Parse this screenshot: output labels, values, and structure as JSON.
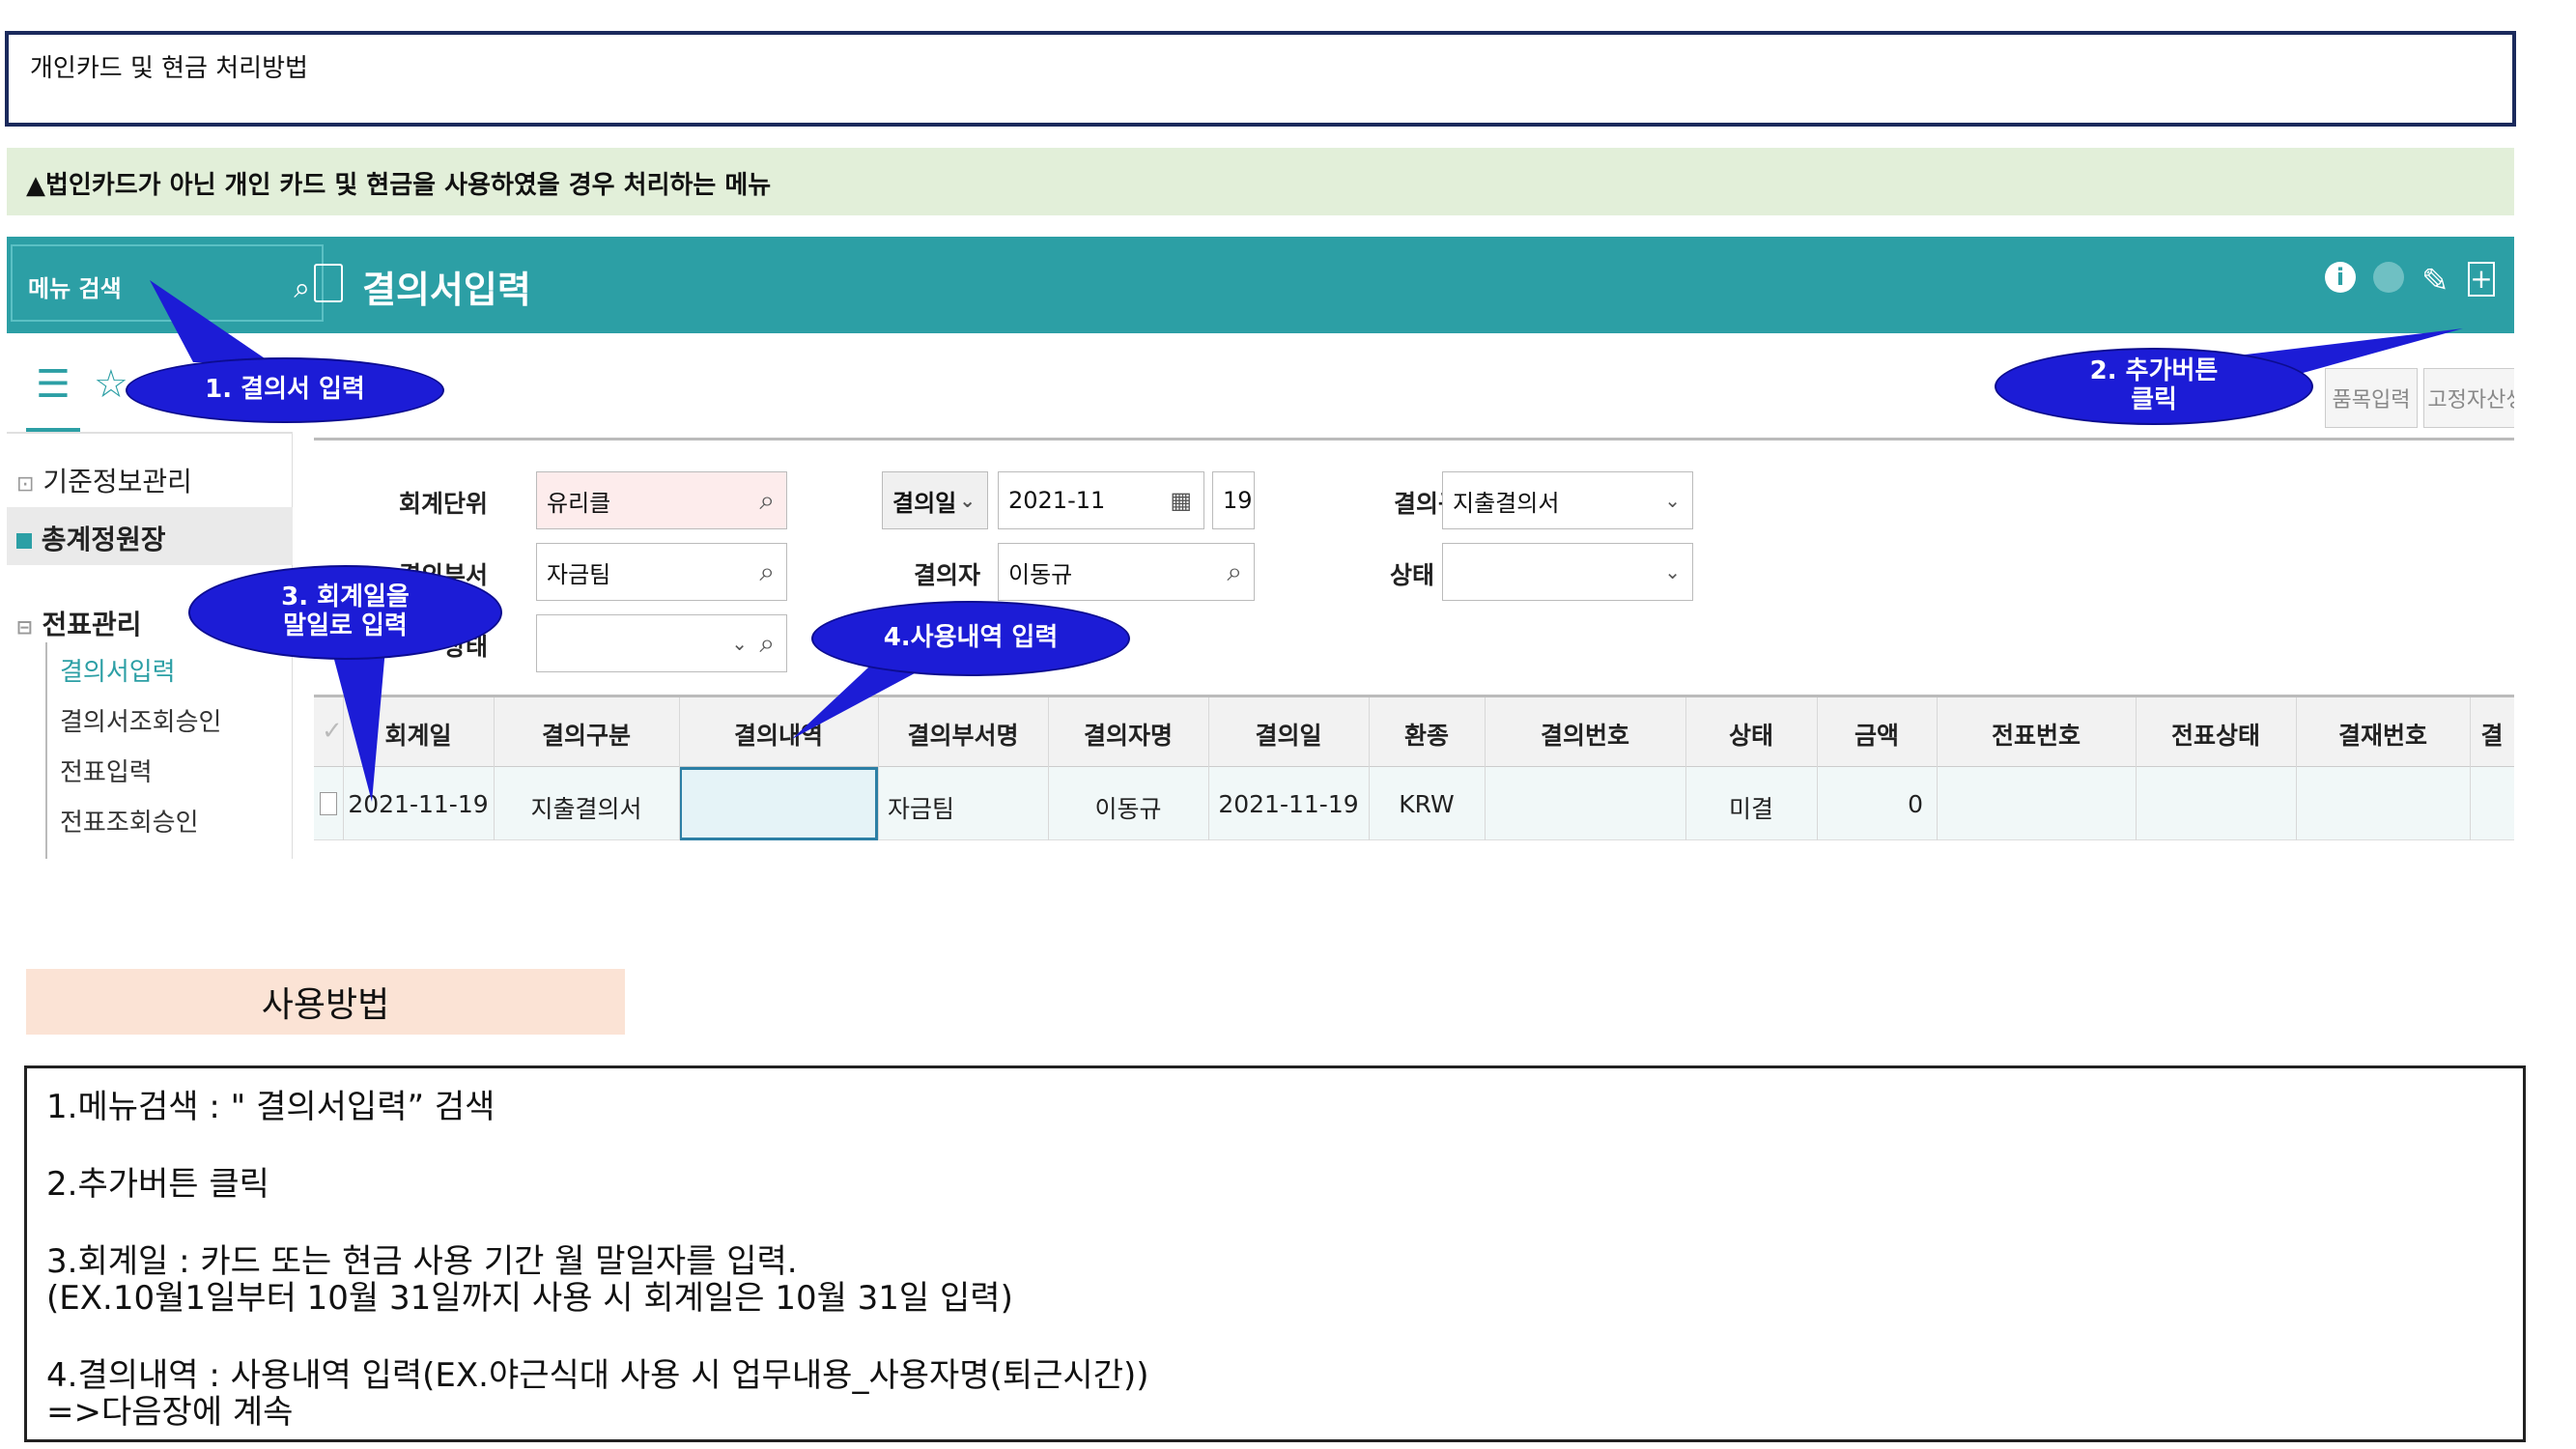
{
  "title": "개인카드 및 현금 처리방법",
  "subtitle": "▲법인카드가 아닌 개인 카드 및 현금을 사용하였을 경우 처리하는 메뉴",
  "app": {
    "menu_search_label": "메뉴 검색",
    "window_title": "결의서입력",
    "icons": [
      "info-icon",
      "globe-icon",
      "pen-icon",
      "add-icon"
    ],
    "buttons": {
      "item_input": "품목입력",
      "fixed_asset": "고정자산생"
    },
    "sidebar": {
      "items": [
        "기준정보관리",
        "총계정원장",
        "전표관리"
      ],
      "sub_items": [
        "결의서입력",
        "결의서조회승인",
        "전표입력",
        "전표조회승인"
      ]
    },
    "form": {
      "accounting_unit_label": "회계단위",
      "accounting_unit_value": "유리클",
      "resolution_date_label": "결의일",
      "resolution_date_value": "2021-11",
      "resolution_day_value": "19",
      "resolution_type_label": "결의구분",
      "resolution_type_value": "지출결의서",
      "dept_label": "결의부서",
      "dept_value": "자금팀",
      "resolver_label": "결의자",
      "resolver_value": "이동규",
      "status_label": "상태",
      "status_value": "",
      "state_label_partial": "상태"
    },
    "grid": {
      "headers": [
        "회계일",
        "결의구분",
        "결의내역",
        "결의부서명",
        "결의자명",
        "결의일",
        "환종",
        "결의번호",
        "상태",
        "금액",
        "전표번호",
        "전표상태",
        "결재번호",
        "결"
      ],
      "row": [
        "2021-11-19",
        "지출결의서",
        "",
        "자금팀",
        "이동규",
        "2021-11-19",
        "KRW",
        "",
        "미결",
        "0",
        "",
        "",
        "",
        ""
      ]
    }
  },
  "callouts": {
    "c1": "1. 결의서 입력",
    "c2_line1": "2. 추가버튼",
    "c2_line2": "클릭",
    "c3_line1": "3. 회계일을",
    "c3_line2": "말일로 입력",
    "c4": "4.사용내역 입력"
  },
  "howto": {
    "title": "사용방법",
    "lines": [
      "1.메뉴검색 : \" 결의서입력” 검색",
      "2.추가버튼 클릭",
      "3.회계일 : 카드 또는 현금 사용 기간 월 말일자를 입력.",
      "(EX.10월1일부터 10월 31일까지 사용 시 회계일은 10월 31일 입력)",
      "4.결의내역 : 사용내역 입력(EX.야근식대 사용 시 업무내용_사용자명(퇴근시간))",
      "=>다음장에 계속"
    ]
  }
}
